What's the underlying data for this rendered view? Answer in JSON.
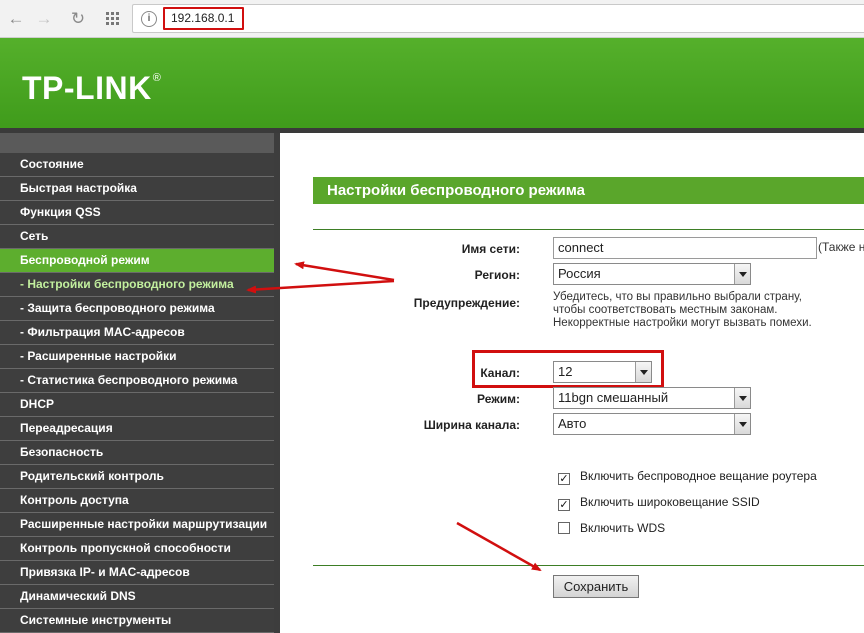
{
  "browser": {
    "url": "192.168.0.1",
    "icons": [
      "back-icon",
      "forward-icon",
      "reload-icon",
      "apps-grid-icon",
      "site-info-icon"
    ]
  },
  "header": {
    "logo": "TP-LINK",
    "logo_mark": "®"
  },
  "sidebar": {
    "items": [
      {
        "label": "Состояние",
        "state": "normal"
      },
      {
        "label": "Быстрая настройка",
        "state": "normal"
      },
      {
        "label": "Функция QSS",
        "state": "normal"
      },
      {
        "label": "Сеть",
        "state": "normal"
      },
      {
        "label": "Беспроводной режим",
        "state": "active"
      },
      {
        "label": "- Настройки беспроводного режима",
        "state": "active-sub"
      },
      {
        "label": "- Защита беспроводного режима",
        "state": "sub"
      },
      {
        "label": "- Фильтрация MAC-адресов",
        "state": "sub"
      },
      {
        "label": "- Расширенные настройки",
        "state": "sub"
      },
      {
        "label": "- Статистика беспроводного режима",
        "state": "sub"
      },
      {
        "label": "DHCP",
        "state": "normal"
      },
      {
        "label": "Переадресация",
        "state": "normal"
      },
      {
        "label": "Безопасность",
        "state": "normal"
      },
      {
        "label": "Родительский контроль",
        "state": "normal"
      },
      {
        "label": "Контроль доступа",
        "state": "normal"
      },
      {
        "label": "Расширенные настройки маршрутизации",
        "state": "normal"
      },
      {
        "label": "Контроль пропускной способности",
        "state": "normal"
      },
      {
        "label": "Привязка IP- и MAC-адресов",
        "state": "normal"
      },
      {
        "label": "Динамический DNS",
        "state": "normal"
      },
      {
        "label": "Системные инструменты",
        "state": "normal"
      }
    ]
  },
  "main": {
    "title": "Настройки беспроводного режима",
    "ssid_label": "Имя сети:",
    "ssid_value": "connect",
    "ssid_note": "(Также н",
    "region_label": "Регион:",
    "region_value": "Россия",
    "warning_label": "Предупреждение:",
    "warning_line1": "Убедитесь, что вы правильно выбрали страну,",
    "warning_line2": "чтобы соответствовать местным законам.",
    "warning_line3": "Некорректные настройки могут вызвать помехи.",
    "channel_label": "Канал:",
    "channel_value": "12",
    "mode_label": "Режим:",
    "mode_value": "11bgn смешанный",
    "width_label": "Ширина канала:",
    "width_value": "Авто",
    "check_broadcast": "Включить беспроводное вещание роутера",
    "check_ssid": "Включить широковещание SSID",
    "check_wds": "Включить WDS",
    "checks_state": [
      true,
      true,
      false
    ],
    "save_label": "Сохранить"
  },
  "colors": {
    "green": "#5aa62b",
    "sidebar_dark": "#3e3e3e",
    "annotation_red": "#d10f0f"
  }
}
